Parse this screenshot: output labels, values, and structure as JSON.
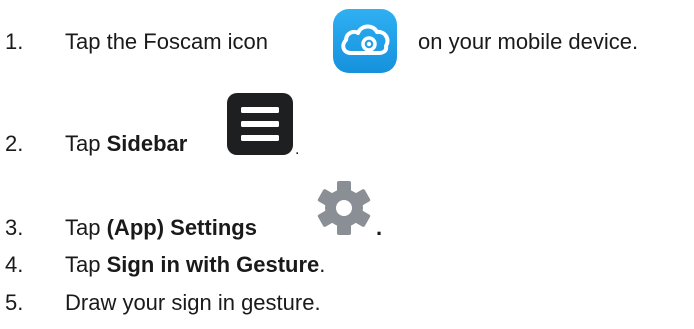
{
  "steps": [
    {
      "number": "1.",
      "prefix": "Tap the Foscam icon",
      "suffix": "on your mobile device.",
      "icon": "foscam-cloud-icon"
    },
    {
      "number": "2.",
      "prefix": "Tap",
      "bold": "Sidebar",
      "suffix": ".",
      "icon": "sidebar-menu-icon"
    },
    {
      "number": "3.",
      "prefix": "Tap",
      "bold": "(App) Settings",
      "suffix": ".",
      "icon": "settings-gear-icon"
    },
    {
      "number": "4.",
      "prefix": "Tap",
      "bold": "Sign in with Gesture",
      "suffix": "."
    },
    {
      "number": "5.",
      "prefix": "Draw your sign in gesture."
    }
  ],
  "colors": {
    "text": "#1a1a1a",
    "foscam_icon_bg": "#1a9be6",
    "menu_icon_bg": "#1e1f21",
    "gear_color": "#8a8f96"
  }
}
